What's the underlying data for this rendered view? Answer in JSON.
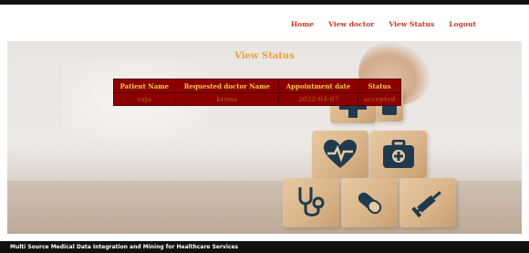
{
  "nav": {
    "items": [
      "Home",
      "View doctor",
      "View Status",
      "Logout"
    ]
  },
  "page": {
    "title": "View Status"
  },
  "table": {
    "headers": [
      "Patient Name",
      "Requested doctor Name",
      "Appointment date",
      "Status"
    ],
    "rows": [
      [
        "raja",
        "kruna",
        "2022-04-07",
        "accepted"
      ]
    ]
  },
  "footer": {
    "text": "Multi Source Medical Data Integration and Mining for Healthcare Services"
  },
  "colors": {
    "nav_link": "#c0392b",
    "title": "#e8a33a",
    "table_bg": "#8b0000",
    "table_header_text": "#f1c84b",
    "footer_bg": "#111111"
  },
  "icons": [
    "medical-cross-icon",
    "heart-pulse-icon",
    "first-aid-kit-icon",
    "stethoscope-icon",
    "pill-icon",
    "syringe-icon"
  ]
}
